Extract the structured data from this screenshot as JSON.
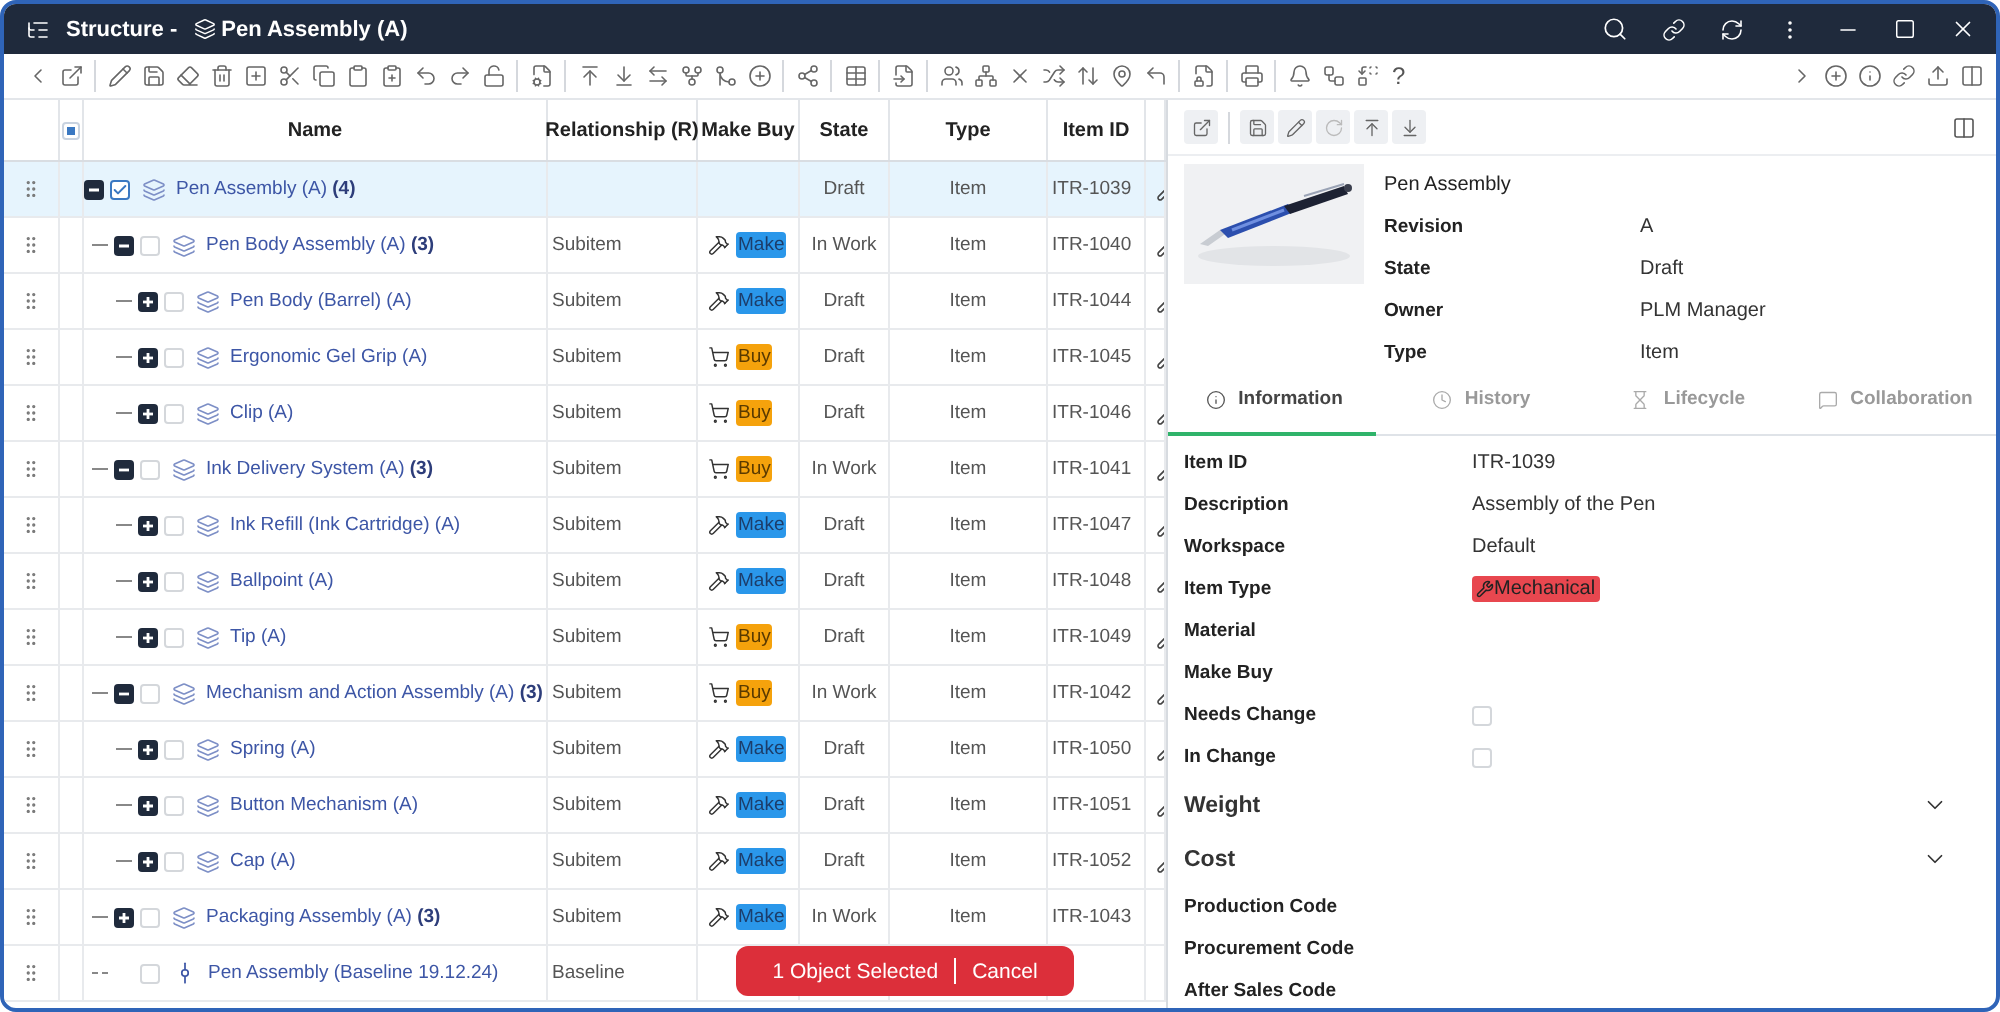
{
  "window": {
    "title_prefix": "Structure - ",
    "title_object": "Pen Assembly (A)"
  },
  "toolbar": {
    "help": "?"
  },
  "table": {
    "columns": [
      "Name",
      "Relationship (R)",
      "Make Buy",
      "State",
      "Type",
      "Item ID"
    ],
    "select_all": {
      "checked": false,
      "partial": true
    },
    "rows": [
      {
        "name": "Pen Assembly (A)",
        "count": "(4)",
        "state": "Draft",
        "type": "Item",
        "item_id": "ITR-1039",
        "kind": "item",
        "selected": true,
        "checked": true,
        "expanded": true,
        "has_link": true,
        "children": [
          {
            "name": "Pen Body Assembly (A)",
            "count": "(3)",
            "relationship": "Subitem",
            "make_buy": {
              "kind": "make",
              "label": "Make"
            },
            "state": "In Work",
            "type": "Item",
            "item_id": "ITR-1040",
            "kind": "item",
            "selected": false,
            "checked": false,
            "expanded": true,
            "has_link": true,
            "children": [
              {
                "name": "Pen Body (Barrel) (A)",
                "relationship": "Subitem",
                "make_buy": {
                  "kind": "make",
                  "label": "Make"
                },
                "state": "Draft",
                "type": "Item",
                "item_id": "ITR-1044",
                "kind": "item",
                "selected": false,
                "checked": false,
                "expanded": false,
                "has_link": true
              },
              {
                "name": "Ergonomic Gel Grip (A)",
                "relationship": "Subitem",
                "make_buy": {
                  "kind": "buy",
                  "label": "Buy"
                },
                "state": "Draft",
                "type": "Item",
                "item_id": "ITR-1045",
                "kind": "item",
                "selected": false,
                "checked": false,
                "expanded": false,
                "has_link": true
              },
              {
                "name": "Clip (A)",
                "relationship": "Subitem",
                "make_buy": {
                  "kind": "buy",
                  "label": "Buy"
                },
                "state": "Draft",
                "type": "Item",
                "item_id": "ITR-1046",
                "kind": "item",
                "selected": false,
                "checked": false,
                "expanded": false,
                "has_link": true
              }
            ]
          },
          {
            "name": "Ink Delivery System (A)",
            "count": "(3)",
            "relationship": "Subitem",
            "make_buy": {
              "kind": "buy",
              "label": "Buy"
            },
            "state": "In Work",
            "type": "Item",
            "item_id": "ITR-1041",
            "kind": "item",
            "selected": false,
            "checked": false,
            "expanded": true,
            "has_link": true,
            "children": [
              {
                "name": "Ink Refill (Ink Cartridge) (A)",
                "relationship": "Subitem",
                "make_buy": {
                  "kind": "make",
                  "label": "Make"
                },
                "state": "Draft",
                "type": "Item",
                "item_id": "ITR-1047",
                "kind": "item",
                "selected": false,
                "checked": false,
                "expanded": false,
                "has_link": true
              },
              {
                "name": "Ballpoint (A)",
                "relationship": "Subitem",
                "make_buy": {
                  "kind": "make",
                  "label": "Make"
                },
                "state": "Draft",
                "type": "Item",
                "item_id": "ITR-1048",
                "kind": "item",
                "selected": false,
                "checked": false,
                "expanded": false,
                "has_link": true
              },
              {
                "name": "Tip (A)",
                "relationship": "Subitem",
                "make_buy": {
                  "kind": "buy",
                  "label": "Buy"
                },
                "state": "Draft",
                "type": "Item",
                "item_id": "ITR-1049",
                "kind": "item",
                "selected": false,
                "checked": false,
                "expanded": false,
                "has_link": true
              }
            ]
          },
          {
            "name": "Mechanism and Action Assembly (A)",
            "count": "(3)",
            "relationship": "Subitem",
            "make_buy": {
              "kind": "buy",
              "label": "Buy"
            },
            "state": "In Work",
            "type": "Item",
            "item_id": "ITR-1042",
            "kind": "item",
            "selected": false,
            "checked": false,
            "expanded": true,
            "has_link": true,
            "children": [
              {
                "name": "Spring (A)",
                "relationship": "Subitem",
                "make_buy": {
                  "kind": "make",
                  "label": "Make"
                },
                "state": "Draft",
                "type": "Item",
                "item_id": "ITR-1050",
                "kind": "item",
                "selected": false,
                "checked": false,
                "expanded": false,
                "has_link": true
              },
              {
                "name": "Button Mechanism (A)",
                "relationship": "Subitem",
                "make_buy": {
                  "kind": "make",
                  "label": "Make"
                },
                "state": "Draft",
                "type": "Item",
                "item_id": "ITR-1051",
                "kind": "item",
                "selected": false,
                "checked": false,
                "expanded": false,
                "has_link": true
              },
              {
                "name": "Cap (A)",
                "relationship": "Subitem",
                "make_buy": {
                  "kind": "make",
                  "label": "Make"
                },
                "state": "Draft",
                "type": "Item",
                "item_id": "ITR-1052",
                "kind": "item",
                "selected": false,
                "checked": false,
                "expanded": false,
                "has_link": true
              }
            ]
          },
          {
            "name": "Packaging Assembly (A)",
            "count": "(3)",
            "relationship": "Subitem",
            "make_buy": {
              "kind": "make",
              "label": "Make"
            },
            "state": "In Work",
            "type": "Item",
            "item_id": "ITR-1043",
            "kind": "item",
            "selected": false,
            "checked": false,
            "expanded": false,
            "has_link": false
          },
          {
            "name": "Pen Assembly (Baseline 19.12.24)",
            "relationship": "Baseline",
            "kind": "baseline",
            "selected": false,
            "checked": false,
            "has_link": false
          }
        ]
      }
    ]
  },
  "selection_toast": {
    "message": "1 Object Selected",
    "action": "Cancel"
  },
  "detail": {
    "header": {
      "kind": "picture",
      "title": "Pen Assembly",
      "properties": [
        {
          "label": "Revision",
          "value": "A"
        },
        {
          "label": "State",
          "value": "Draft"
        },
        {
          "label": "Owner",
          "value": "PLM Manager"
        },
        {
          "label": "Type",
          "value": "Item"
        }
      ]
    },
    "tabs": [
      {
        "label": "Information",
        "kind": "info",
        "selected": true
      },
      {
        "label": "History",
        "kind": "history",
        "selected": false
      },
      {
        "label": "Lifecycle",
        "kind": "lifecycle",
        "selected": false
      },
      {
        "label": "Collaboration",
        "kind": "collab",
        "selected": false
      }
    ],
    "fields": [
      {
        "kind": "text",
        "label": "Item ID",
        "value": "ITR-1039"
      },
      {
        "kind": "text",
        "label": "Description",
        "value": "Assembly of the Pen"
      },
      {
        "kind": "text",
        "label": "Workspace",
        "value": "Default"
      },
      {
        "kind": "tag",
        "label": "Item Type",
        "value": "Mechanical",
        "color": "#e8474f"
      },
      {
        "kind": "text",
        "label": "Material"
      },
      {
        "kind": "text",
        "label": "Make Buy"
      },
      {
        "kind": "checkbox",
        "label": "Needs Change",
        "checked": false
      },
      {
        "kind": "checkbox",
        "label": "In Change",
        "checked": false
      },
      {
        "kind": "section",
        "label": "Weight",
        "expanded": false
      },
      {
        "kind": "section",
        "label": "Cost",
        "expanded": false
      },
      {
        "kind": "text",
        "label": "Production Code"
      },
      {
        "kind": "text",
        "label": "Procurement Code"
      },
      {
        "kind": "text",
        "label": "After Sales Code"
      }
    ]
  }
}
